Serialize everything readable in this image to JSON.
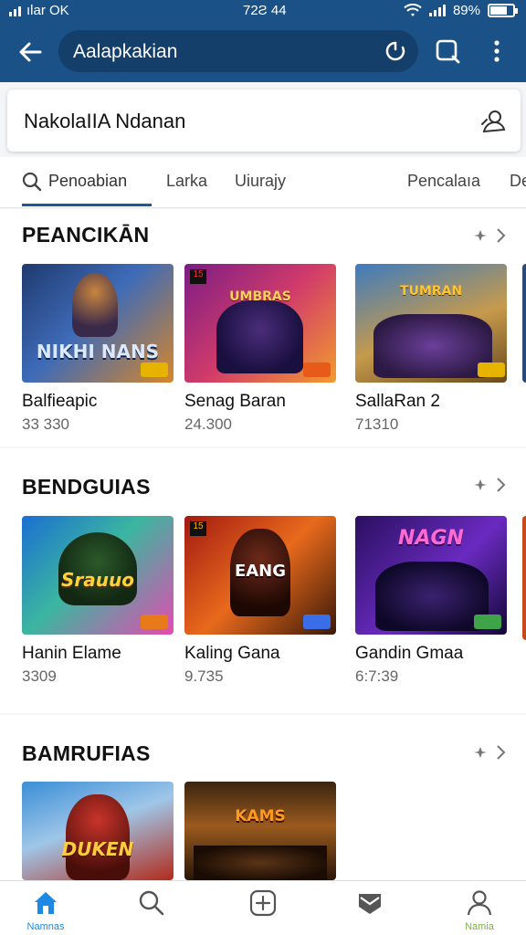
{
  "status_bar": {
    "carrier": "ılar OK",
    "time": "72Ƨ 44",
    "battery": "89%"
  },
  "header": {
    "search_text": "Aalapkakian"
  },
  "search": {
    "query": "NakolaIIA Ndanan"
  },
  "tabs": [
    {
      "label": "Penoabian"
    },
    {
      "label": "Larka"
    },
    {
      "label": "Uiurajy"
    },
    {
      "label": "Pencalaıa"
    },
    {
      "label": "De"
    }
  ],
  "sections": [
    {
      "title": "PEANCIKĀN",
      "cards": [
        {
          "name": "Balfieapic",
          "count": "33 330",
          "logo": "NIKHI NANS"
        },
        {
          "name": "Senag Baran",
          "count": "24.300",
          "logo": "UMBRAS"
        },
        {
          "name": "SallaRan 2",
          "count": "71310",
          "logo": "TUMRAN"
        }
      ]
    },
    {
      "title": "BENDGUIAS",
      "cards": [
        {
          "name": "Hanin Elame",
          "count": "3309",
          "logo": "Srauuo"
        },
        {
          "name": "Kaling Gana",
          "count": "9.735",
          "logo": "EANG"
        },
        {
          "name": "Gandin Gmaa",
          "count": "6:7:39",
          "logo": "NAGN"
        }
      ]
    },
    {
      "title": "BAMRUFIAS",
      "cards": [
        {
          "name": "",
          "count": "",
          "logo": "DUKEN"
        },
        {
          "name": "",
          "count": "",
          "logo": "KAMS"
        }
      ]
    }
  ],
  "bottom_nav": [
    {
      "label": "Namnas",
      "icon": "home-icon",
      "color": "#1e88e5"
    },
    {
      "label": "",
      "icon": "search-icon",
      "color": "#555555"
    },
    {
      "label": "",
      "icon": "add-icon",
      "color": "#555555"
    },
    {
      "label": "",
      "icon": "inbox-icon",
      "color": "#555555"
    },
    {
      "label": "Namia",
      "icon": "profile-icon",
      "color": "#7cb342"
    }
  ],
  "colors": {
    "header": "#1a5288",
    "accent": "#1a5a9a"
  }
}
